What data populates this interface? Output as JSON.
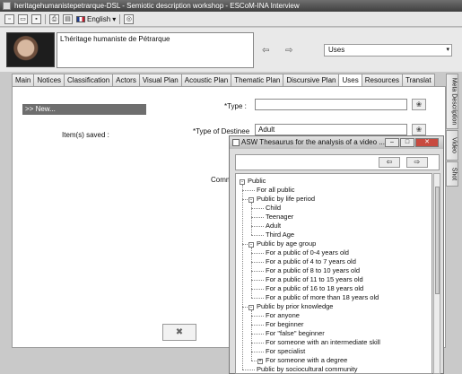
{
  "window": {
    "title": "heritagehumanistepetrarque-DSL - Semiotic description workshop - ESCoM-INA Interview"
  },
  "toolbar": {
    "language": "English"
  },
  "video": {
    "title": "L'héritage humaniste de Pétrarque"
  },
  "selector": {
    "value": "Uses"
  },
  "tabs": [
    "Main",
    "Notices",
    "Classification",
    "Actors",
    "Visual Plan",
    "Acoustic Plan",
    "Thematic Plan",
    "Discursive Plan",
    "Uses",
    "Resources",
    "Translat"
  ],
  "side_tabs": [
    "Meta Description",
    "Video",
    "Shot"
  ],
  "left_panel": {
    "new_item": ">> New...",
    "saved_label": "Item(s) saved :"
  },
  "form": {
    "type_label": "*Type :",
    "type_value": "",
    "destinee_label": "*Type of Destinee",
    "destinee_value": "Adult",
    "comment_label": "Comm"
  },
  "thesaurus": {
    "title": "ASW Thesaurus for the analysis of a video ...",
    "tree": [
      {
        "label": "Public",
        "level": 0,
        "toggle": "-"
      },
      {
        "label": "For all public",
        "level": 1,
        "toggle": ""
      },
      {
        "label": "Public by life period",
        "level": 1,
        "toggle": "-"
      },
      {
        "label": "Child",
        "level": 2,
        "toggle": ""
      },
      {
        "label": "Teenager",
        "level": 2,
        "toggle": ""
      },
      {
        "label": "Adult",
        "level": 2,
        "toggle": ""
      },
      {
        "label": "Third Age",
        "level": 2,
        "toggle": ""
      },
      {
        "label": "Public by age group",
        "level": 1,
        "toggle": "-"
      },
      {
        "label": "For a public of 0-4 years old",
        "level": 2,
        "toggle": ""
      },
      {
        "label": "For a public of 4 to 7 years old",
        "level": 2,
        "toggle": ""
      },
      {
        "label": "For a public of 8 to 10 years old",
        "level": 2,
        "toggle": ""
      },
      {
        "label": "For a public of 11 to 15 years old",
        "level": 2,
        "toggle": ""
      },
      {
        "label": "For a public of 16 to 18 years old",
        "level": 2,
        "toggle": ""
      },
      {
        "label": "For a public of more than 18 years old",
        "level": 2,
        "toggle": ""
      },
      {
        "label": "Public by prior knowledge",
        "level": 1,
        "toggle": "-"
      },
      {
        "label": "For anyone",
        "level": 2,
        "toggle": ""
      },
      {
        "label": "For beginner",
        "level": 2,
        "toggle": ""
      },
      {
        "label": "For \"false\" beginner",
        "level": 2,
        "toggle": ""
      },
      {
        "label": "For someone with an intermediate skill",
        "level": 2,
        "toggle": ""
      },
      {
        "label": "For specialist",
        "level": 2,
        "toggle": ""
      },
      {
        "label": "For someone with a degree",
        "level": 2,
        "toggle": "+"
      },
      {
        "label": "Public by sociocultural  community",
        "level": 1,
        "toggle": ""
      }
    ]
  },
  "icons": {
    "new_doc": "new-document-icon",
    "open": "open-folder-icon",
    "save": "save-icon",
    "print": "print-icon",
    "help": "help-icon",
    "prev": "arrow-left-icon",
    "next": "arrow-right-icon",
    "paw": "thesaurus-paw-icon",
    "delete": "delete-icon"
  }
}
